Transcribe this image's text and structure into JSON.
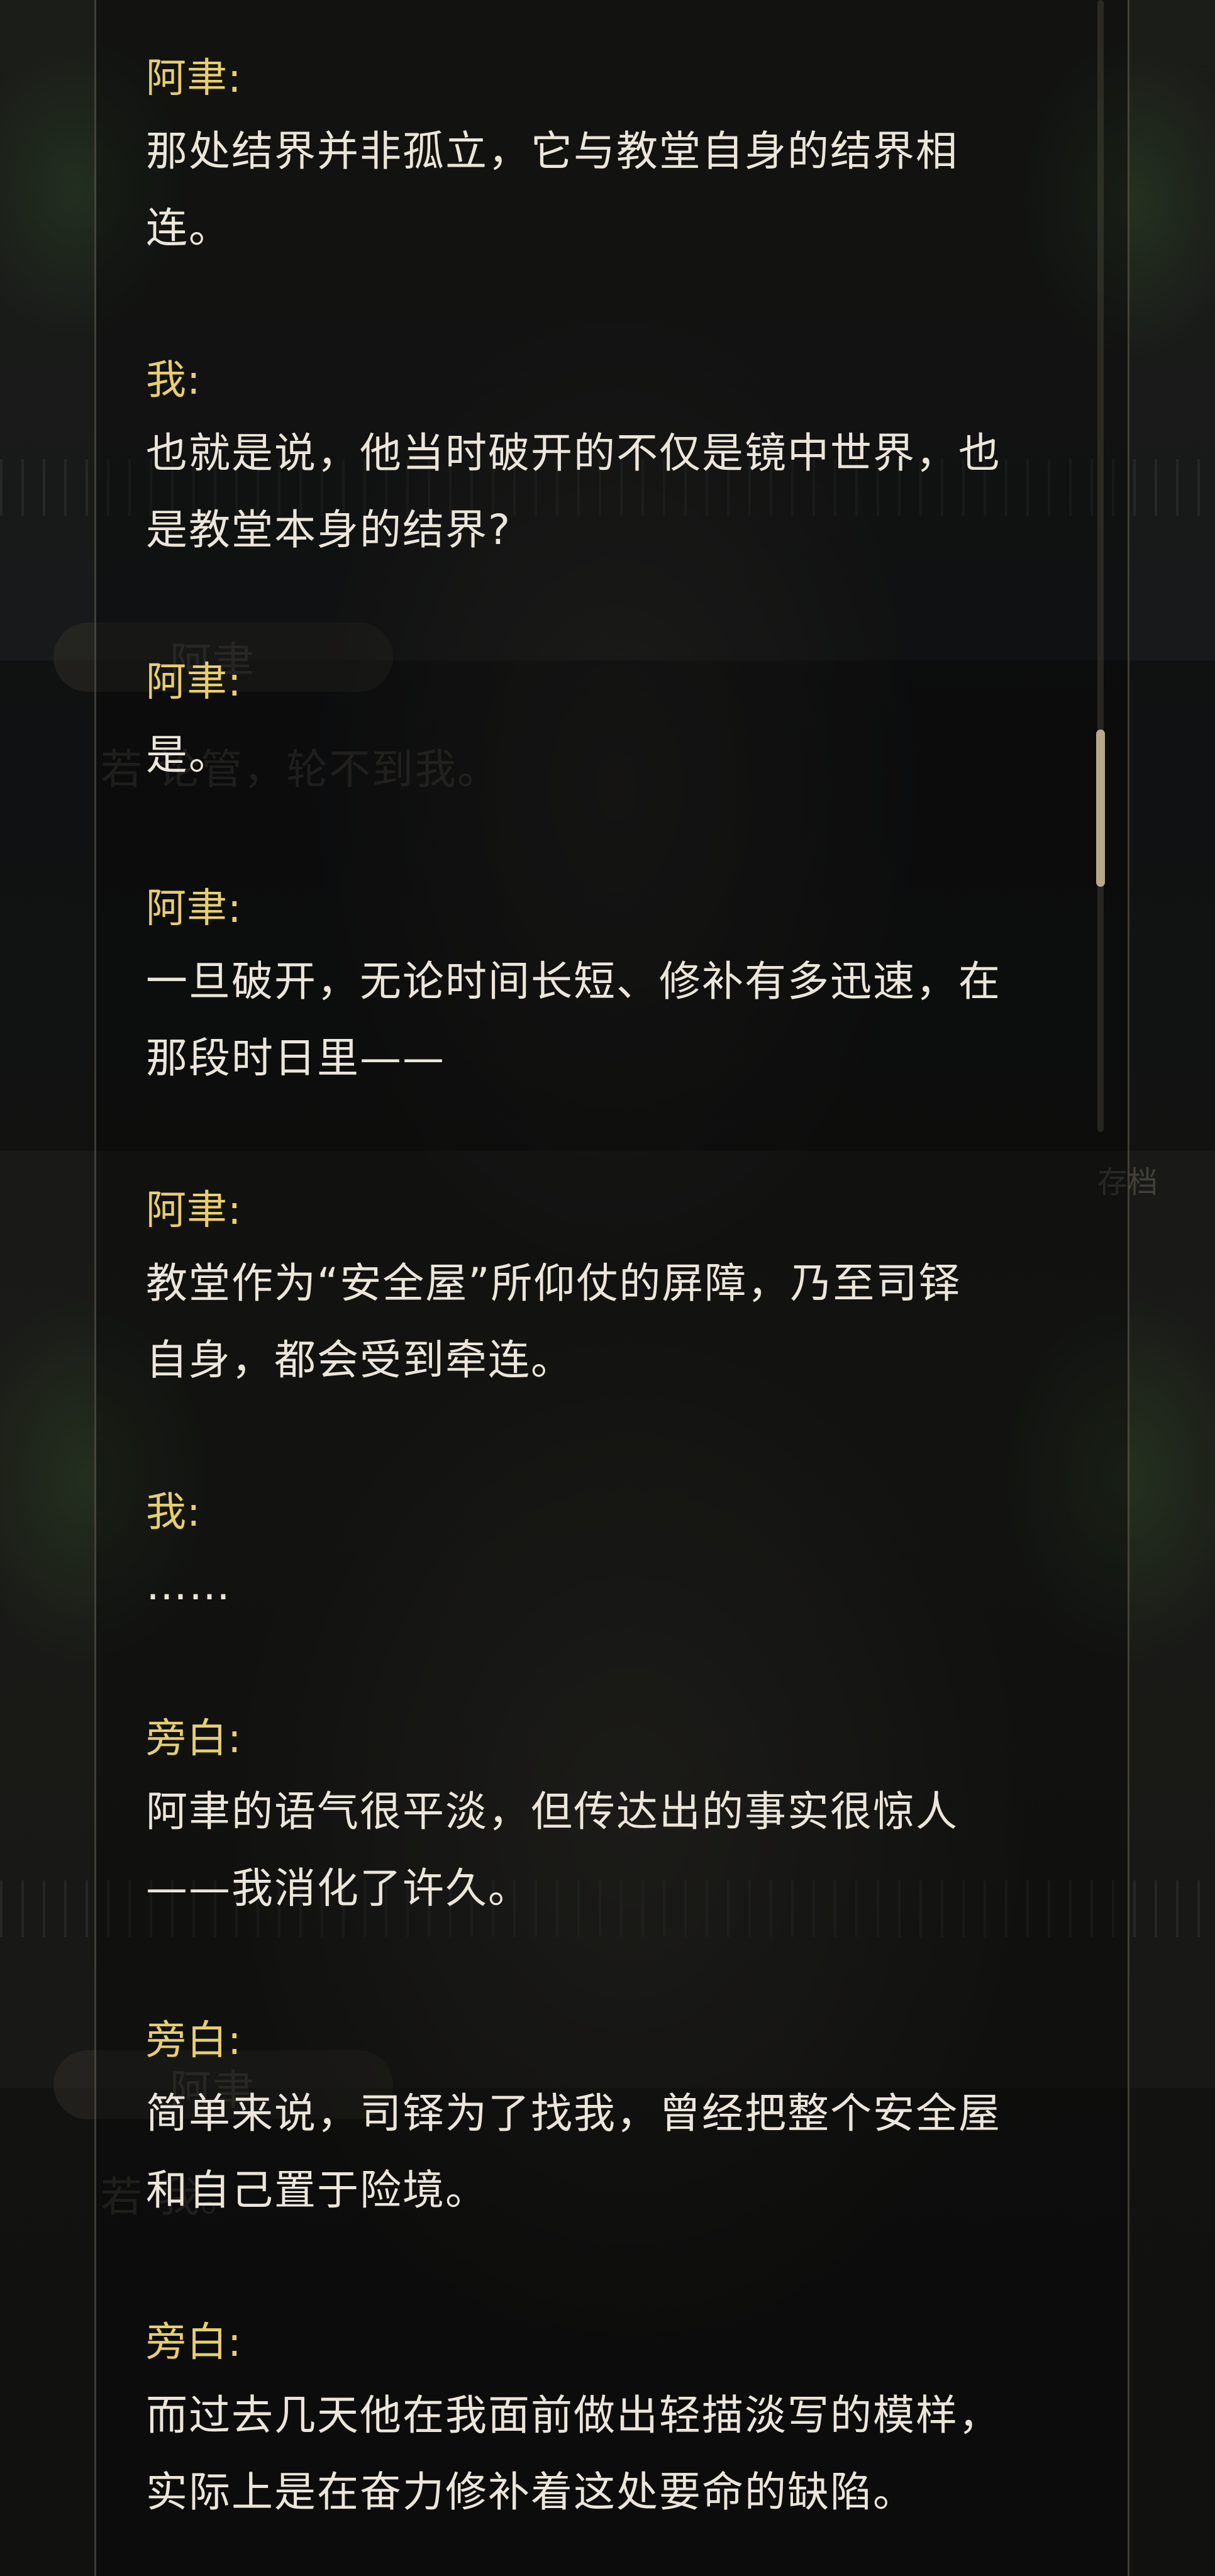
{
  "background": {
    "ghost_speaker_1": "阿聿",
    "ghost_line_1": "若  论管，轮不到我。",
    "ghost_speaker_2": "阿聿",
    "ghost_line_2": "若              我。",
    "ghost_save": "存档"
  },
  "colors": {
    "speaker": "#e8cf6c",
    "text": "#ece6da",
    "scroll_thumb": "#b9a98b"
  },
  "dialog_log": [
    {
      "speaker": "阿聿:",
      "lines": [
        "那处结界并非孤立，它与教堂自身的结界相",
        "连。"
      ]
    },
    {
      "speaker": "我:",
      "lines": [
        "也就是说，他当时破开的不仅是镜中世界，也",
        "是教堂本身的结界?"
      ]
    },
    {
      "speaker": "阿聿:",
      "lines": [
        "是。"
      ]
    },
    {
      "speaker": "阿聿:",
      "lines": [
        "一旦破开，无论时间长短、修补有多迅速，在",
        "那段时日里——"
      ]
    },
    {
      "speaker": "阿聿:",
      "lines": [
        "教堂作为“安全屋”所仰仗的屏障，乃至司铎",
        "自身，都会受到牵连。"
      ]
    },
    {
      "speaker": "我:",
      "lines": [
        "……"
      ]
    },
    {
      "speaker": "旁白:",
      "lines": [
        "阿聿的语气很平淡，但传达出的事实很惊人",
        "——我消化了许久。"
      ]
    },
    {
      "speaker": "旁白:",
      "lines": [
        "简单来说，司铎为了找我，曾经把整个安全屋",
        "和自己置于险境。"
      ]
    },
    {
      "speaker": "旁白:",
      "lines": [
        "而过去几天他在我面前做出轻描淡写的模样，",
        "实际上是在奋力修补着这处要命的缺陷。"
      ]
    }
  ]
}
